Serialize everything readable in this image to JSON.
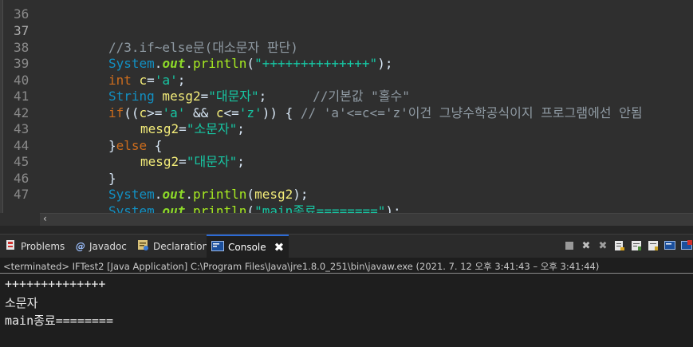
{
  "editor": {
    "lines": [
      {
        "num": "36",
        "current": false
      },
      {
        "num": "37",
        "current": true
      },
      {
        "num": "38",
        "current": false
      },
      {
        "num": "39",
        "current": false
      },
      {
        "num": "40",
        "current": false
      },
      {
        "num": "41",
        "current": false
      },
      {
        "num": "42",
        "current": false
      },
      {
        "num": "43",
        "current": false
      },
      {
        "num": "44",
        "current": false
      },
      {
        "num": "45",
        "current": false
      },
      {
        "num": "46",
        "current": false
      },
      {
        "num": "47",
        "current": false
      }
    ],
    "code": {
      "l37_comment": "//3.if~else문(대소문자 판단)",
      "system": "System",
      "dot": ".",
      "out": "out",
      "println": "println",
      "l38_str": "\"++++++++++++++\"",
      "l38_end": ");",
      "kw_int": "int",
      "l39_var": " c",
      "l39_eq": "=",
      "l39_str": "'a'",
      "semi": ";",
      "kw_string": "String",
      "l40_var": " mesg2",
      "l40_str": "\"대문자\"",
      "l40_semi": ";      ",
      "l40_comment": "//기본값 \"홀수\"",
      "kw_if": "if",
      "l41_a": "((",
      "l41_c1": "c",
      "l41_b": ">=",
      "l41_s1": "'a'",
      "l41_and": " && ",
      "l41_c2": "c",
      "l41_le": "<=",
      "l41_s2": "'z'",
      "l41_close": ")) { ",
      "l41_comment": "// 'a'<=c<='z'이건 그냥수학공식이지 프로그램에선 안됨",
      "l42_var": "mesg2",
      "l42_str": "\"소문자\"",
      "l43_brace": "}",
      "kw_else": "else",
      "l43_open": " {",
      "l44_var": "mesg2",
      "l44_str": "\"대문자\"",
      "l45_brace": "}",
      "l46_open": "(",
      "l46_var": "mesg2",
      "l46_end": ");",
      "l47_str": "\"main종료========\"",
      "l47_end": ");"
    },
    "hscroll_arrow": "‹"
  },
  "views": {
    "tabs": [
      {
        "label": "Problems",
        "icon": "problems-icon"
      },
      {
        "label": "Javadoc",
        "icon": "javadoc-icon"
      },
      {
        "label": "Declaration",
        "icon": "declaration-icon"
      },
      {
        "label": "Console",
        "icon": "console-icon",
        "close": "✖"
      }
    ],
    "toolbar_icons": [
      "terminate-icon",
      "remove-launch-icon",
      "remove-all-icon",
      "scroll-lock-icon",
      "word-wrap-icon",
      "pin-icon",
      "display-console-icon",
      "open-console-icon"
    ]
  },
  "console": {
    "terminated": "<terminated> IFTest2 [Java Application] C:\\Program Files\\Java\\jre1.8.0_251\\bin\\javaw.exe  (2021. 7. 12 오후 3:41:43 – 오후 3:41:44)",
    "output": [
      "++++++++++++++",
      "소문자",
      "main종료========"
    ]
  },
  "colors": {
    "editor_bg": "#2f2f2f",
    "console_bg": "#1e1e1e",
    "active_tab_border": "#2b6ad6"
  }
}
